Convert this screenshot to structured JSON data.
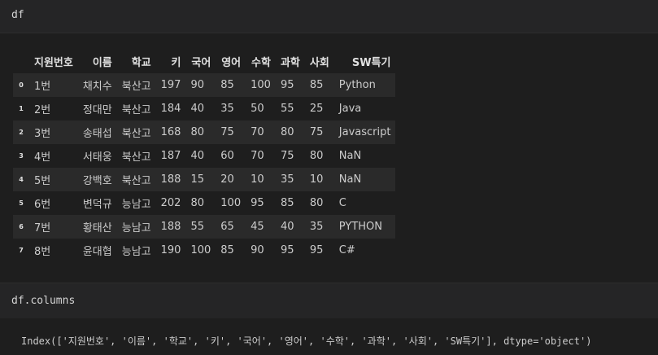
{
  "cells": [
    {
      "input": "df"
    },
    {
      "input": "df.columns"
    }
  ],
  "table": {
    "columns": [
      "지원번호",
      "이름",
      "학교",
      "키",
      "국어",
      "영어",
      "수학",
      "과학",
      "사회",
      "SW특기"
    ],
    "rows": [
      {
        "index": "0",
        "values": [
          "1번",
          "채치수",
          "북산고",
          "197",
          "90",
          "85",
          "100",
          "95",
          "85",
          "Python"
        ]
      },
      {
        "index": "1",
        "values": [
          "2번",
          "정대만",
          "북산고",
          "184",
          "40",
          "35",
          "50",
          "55",
          "25",
          "Java"
        ]
      },
      {
        "index": "2",
        "values": [
          "3번",
          "송태섭",
          "북산고",
          "168",
          "80",
          "75",
          "70",
          "80",
          "75",
          "Javascript"
        ]
      },
      {
        "index": "3",
        "values": [
          "4번",
          "서태웅",
          "북산고",
          "187",
          "40",
          "60",
          "70",
          "75",
          "80",
          "NaN"
        ]
      },
      {
        "index": "4",
        "values": [
          "5번",
          "강백호",
          "북산고",
          "188",
          "15",
          "20",
          "10",
          "35",
          "10",
          "NaN"
        ]
      },
      {
        "index": "5",
        "values": [
          "6번",
          "변덕규",
          "능남고",
          "202",
          "80",
          "100",
          "95",
          "85",
          "80",
          "C"
        ]
      },
      {
        "index": "6",
        "values": [
          "7번",
          "황태산",
          "능남고",
          "188",
          "55",
          "65",
          "45",
          "40",
          "35",
          "PYTHON"
        ]
      },
      {
        "index": "7",
        "values": [
          "8번",
          "윤대협",
          "능남고",
          "190",
          "100",
          "85",
          "90",
          "95",
          "95",
          "C#"
        ]
      }
    ]
  },
  "columns_output": "Index(['지원번호', '이름', '학교', '키', '국어', '영어', '수학', '과학', '사회', 'SW특기'], dtype='object')"
}
